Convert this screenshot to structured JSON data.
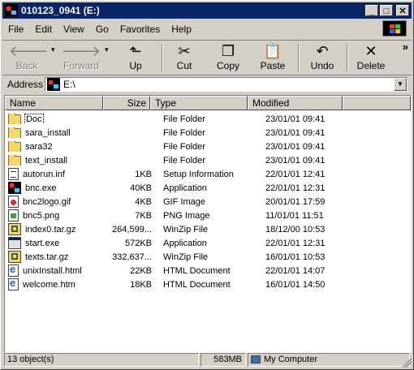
{
  "window": {
    "title": "010123_0941 (E:)",
    "minimize": "_",
    "maximize": "□",
    "close": "✕"
  },
  "menu": [
    {
      "label": "File"
    },
    {
      "label": "Edit"
    },
    {
      "label": "View"
    },
    {
      "label": "Go"
    },
    {
      "label": "Favorites"
    },
    {
      "label": "Help"
    }
  ],
  "toolbar": {
    "back": "Back",
    "forward": "Forward",
    "up": "Up",
    "cut": "Cut",
    "copy": "Copy",
    "paste": "Paste",
    "undo": "Undo",
    "delete": "Delete",
    "more": "»"
  },
  "address": {
    "label": "Address",
    "value": "E:\\"
  },
  "columns": {
    "name": "Name",
    "size": "Size",
    "type": "Type",
    "modified": "Modified"
  },
  "files": [
    {
      "name": "Doc",
      "size": "",
      "type": "File Folder",
      "modified": "23/01/01 09:41",
      "icon": "folder-icon"
    },
    {
      "name": "sara_install",
      "size": "",
      "type": "File Folder",
      "modified": "23/01/01 09:41",
      "icon": "folder-icon"
    },
    {
      "name": "sara32",
      "size": "",
      "type": "File Folder",
      "modified": "23/01/01 09:41",
      "icon": "folder-icon"
    },
    {
      "name": "text_install",
      "size": "",
      "type": "File Folder",
      "modified": "23/01/01 09:41",
      "icon": "folder-icon"
    },
    {
      "name": "autorun.inf",
      "size": "1KB",
      "type": "Setup Information",
      "modified": "22/01/01 12:41",
      "icon": "document-icon"
    },
    {
      "name": "bnc.exe",
      "size": "40KB",
      "type": "Application",
      "modified": "22/01/01 12:31",
      "icon": "bnc-app-icon"
    },
    {
      "name": "bnc2logo.gif",
      "size": "4KB",
      "type": "GIF Image",
      "modified": "20/01/01 17:59",
      "icon": "gif-image-icon"
    },
    {
      "name": "bnc5.png",
      "size": "7KB",
      "type": "PNG Image",
      "modified": "11/01/01 11:51",
      "icon": "png-image-icon"
    },
    {
      "name": "index0.tar.gz",
      "size": "264,599...",
      "type": "WinZip File",
      "modified": "18/12/00 10:53",
      "icon": "winzip-icon"
    },
    {
      "name": "start.exe",
      "size": "572KB",
      "type": "Application",
      "modified": "22/01/01 12:31",
      "icon": "application-icon"
    },
    {
      "name": "texts.tar.gz",
      "size": "332,637...",
      "type": "WinZip File",
      "modified": "16/01/01 10:53",
      "icon": "winzip-icon"
    },
    {
      "name": "unixInstall.html",
      "size": "22KB",
      "type": "HTML Document",
      "modified": "22/01/01 14:07",
      "icon": "html-document-icon"
    },
    {
      "name": "welcome.htm",
      "size": "18KB",
      "type": "HTML Document",
      "modified": "16/01/01 14:50",
      "icon": "html-document-icon"
    }
  ],
  "status": {
    "objects": "13 object(s)",
    "size": "583MB",
    "zone": "My Computer"
  }
}
